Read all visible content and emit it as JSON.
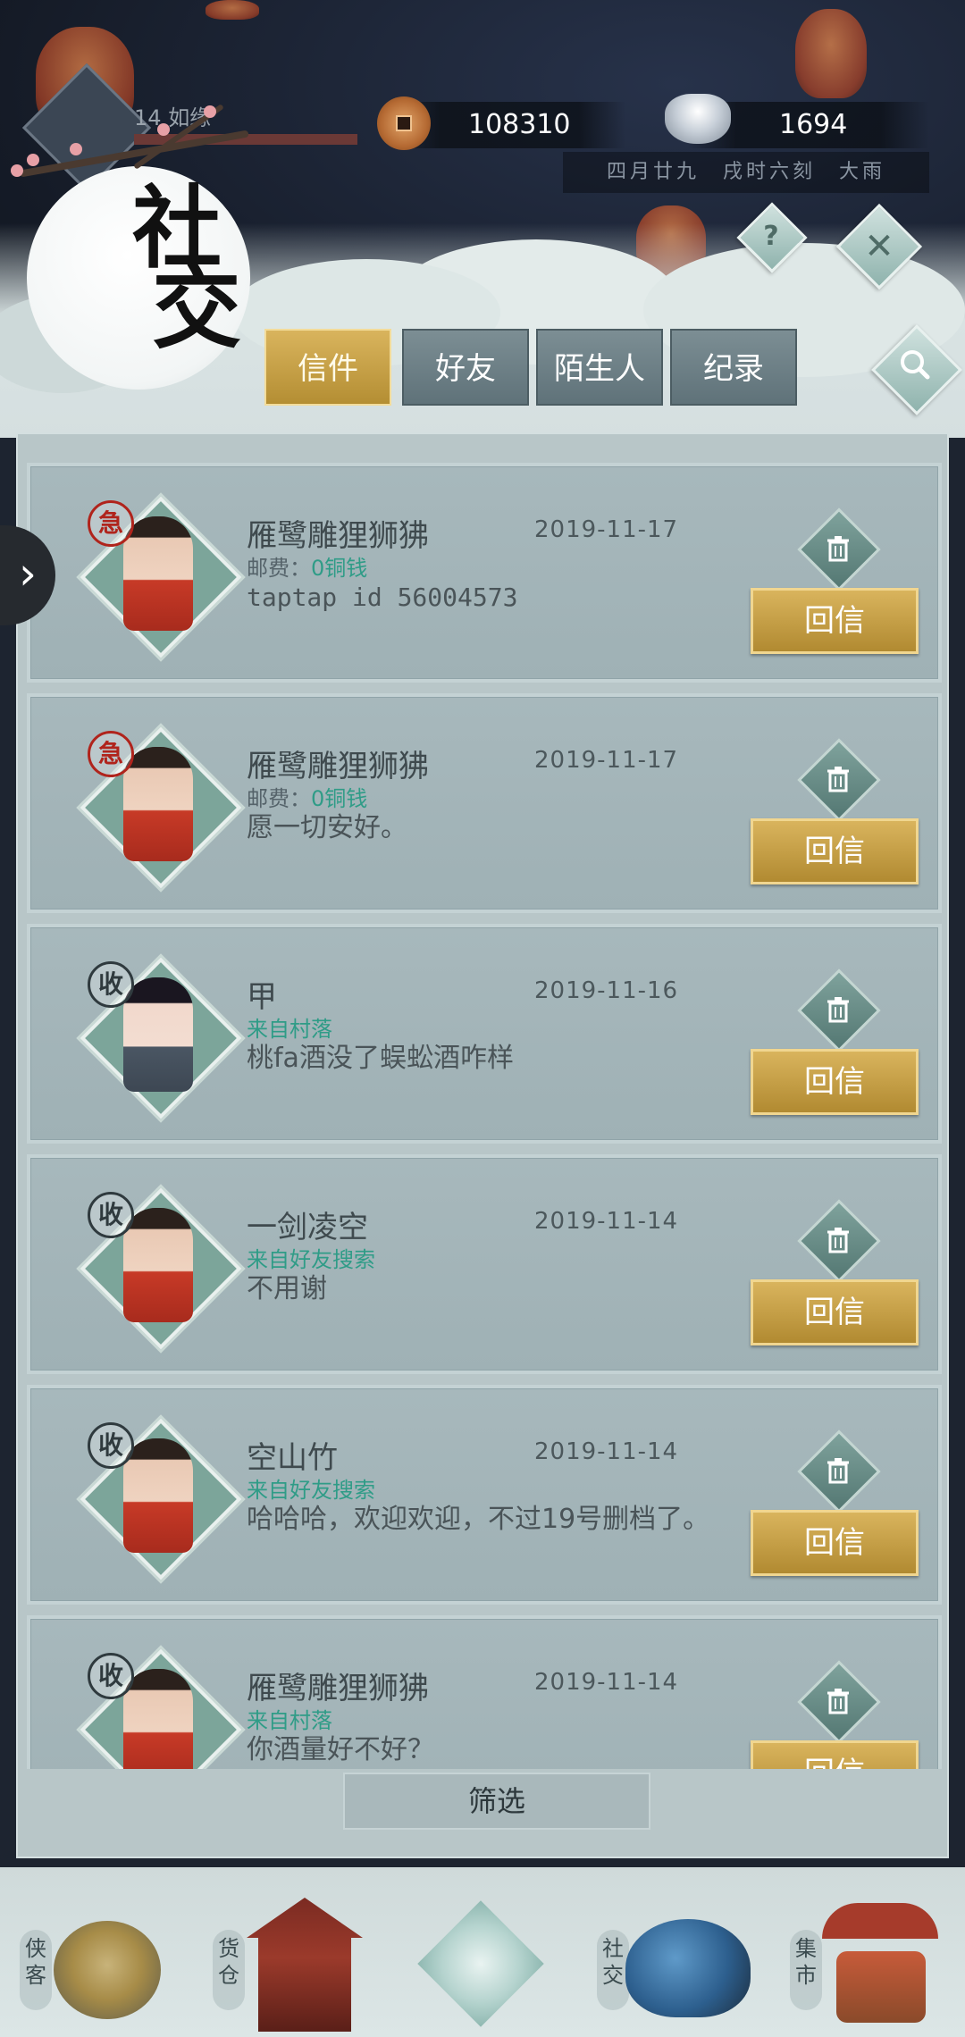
{
  "header": {
    "player_level": "14",
    "player_name": "如缘",
    "copper": "108310",
    "silver": "1694",
    "game_time": "四月廿九　戌时六刻　大雨",
    "title_chars": [
      "社",
      "交"
    ],
    "help_glyph": "?",
    "close_glyph": "✕"
  },
  "tabs": [
    {
      "label": "信件",
      "active": true
    },
    {
      "label": "好友",
      "active": false
    },
    {
      "label": "陌生人",
      "active": false
    },
    {
      "label": "纪录",
      "active": false
    }
  ],
  "letters": [
    {
      "seal": "急",
      "sender": "雁鹭雕狸狮狒",
      "date": "2019-11-17",
      "meta_label": "邮费：",
      "meta_value": "0铜钱",
      "message": "taptap  id  56004573",
      "reply": "回信"
    },
    {
      "seal": "急",
      "sender": "雁鹭雕狸狮狒",
      "date": "2019-11-17",
      "meta_label": "邮费：",
      "meta_value": "0铜钱",
      "message": "愿一切安好。",
      "reply": "回信"
    },
    {
      "seal": "收",
      "sender": "甲",
      "date": "2019-11-16",
      "meta_label": "",
      "meta_value": "来自村落",
      "message": "桃fa酒没了蜈蚣酒咋样",
      "reply": "回信"
    },
    {
      "seal": "收",
      "sender": "一剑凌空",
      "date": "2019-11-14",
      "meta_label": "",
      "meta_value": "来自好友搜索",
      "message": "不用谢",
      "reply": "回信"
    },
    {
      "seal": "收",
      "sender": "空山竹",
      "date": "2019-11-14",
      "meta_label": "",
      "meta_value": "来自好友搜索",
      "message": "哈哈哈，欢迎欢迎，不过19号删档了。",
      "reply": "回信"
    },
    {
      "seal": "收",
      "sender": "雁鹭雕狸狮狒",
      "date": "2019-11-14",
      "meta_label": "",
      "meta_value": "来自村落",
      "message": "你酒量好不好？",
      "reply": "回信"
    }
  ],
  "filter_label": "筛选",
  "bottom_nav": [
    {
      "label": "侠客"
    },
    {
      "label": "货仓"
    },
    {
      "label": ""
    },
    {
      "label": "社交"
    },
    {
      "label": "集市"
    }
  ],
  "icons": {
    "side_tab": "chevron-right-icon",
    "search": "search-icon",
    "trash": "trash-icon",
    "help": "help-icon",
    "close": "close-icon"
  },
  "colors": {
    "accent_gold": "#c9a348",
    "panel": "#b8c6c8",
    "meta_green": "#2f9c87",
    "urgent_red": "#b0241c"
  }
}
